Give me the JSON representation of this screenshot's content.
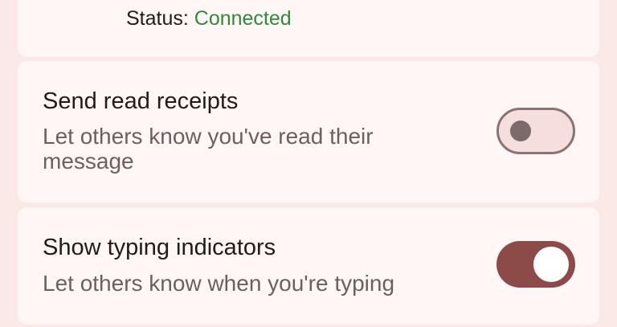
{
  "colors": {
    "page_background": "#fbe9e8",
    "card_background": "#fff7f6",
    "connected_green": "#2f8a3a",
    "toggle_on": "#8c4a48"
  },
  "connection": {
    "icon": "building-icon",
    "status_label": "Status: ",
    "status_value": "Connected"
  },
  "settings": {
    "read_receipts": {
      "title": "Send read receipts",
      "description": "Let others know you've read their message",
      "enabled": false
    },
    "typing_indicators": {
      "title": "Show typing indicators",
      "description": "Let others know when you're typing",
      "enabled": true
    }
  }
}
